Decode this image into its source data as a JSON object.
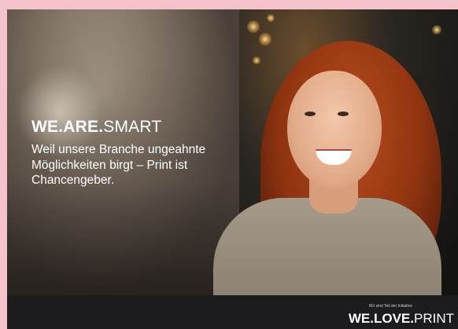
{
  "hero": {
    "headline_bold": "WE.ARE.",
    "headline_light": "SMART",
    "tagline": "Weil unsere Branche ungeahnte Möglichkeiten birgt – Print ist Chancengeber."
  },
  "footer": {
    "note": "Wir sind Teil der Initiative",
    "logo_bold": "WE.LOVE.",
    "logo_light": "PRINT"
  },
  "colors": {
    "frame_pink": "#f3c2cb",
    "footer_bg": "#1c1b1d",
    "text": "#ffffff"
  }
}
